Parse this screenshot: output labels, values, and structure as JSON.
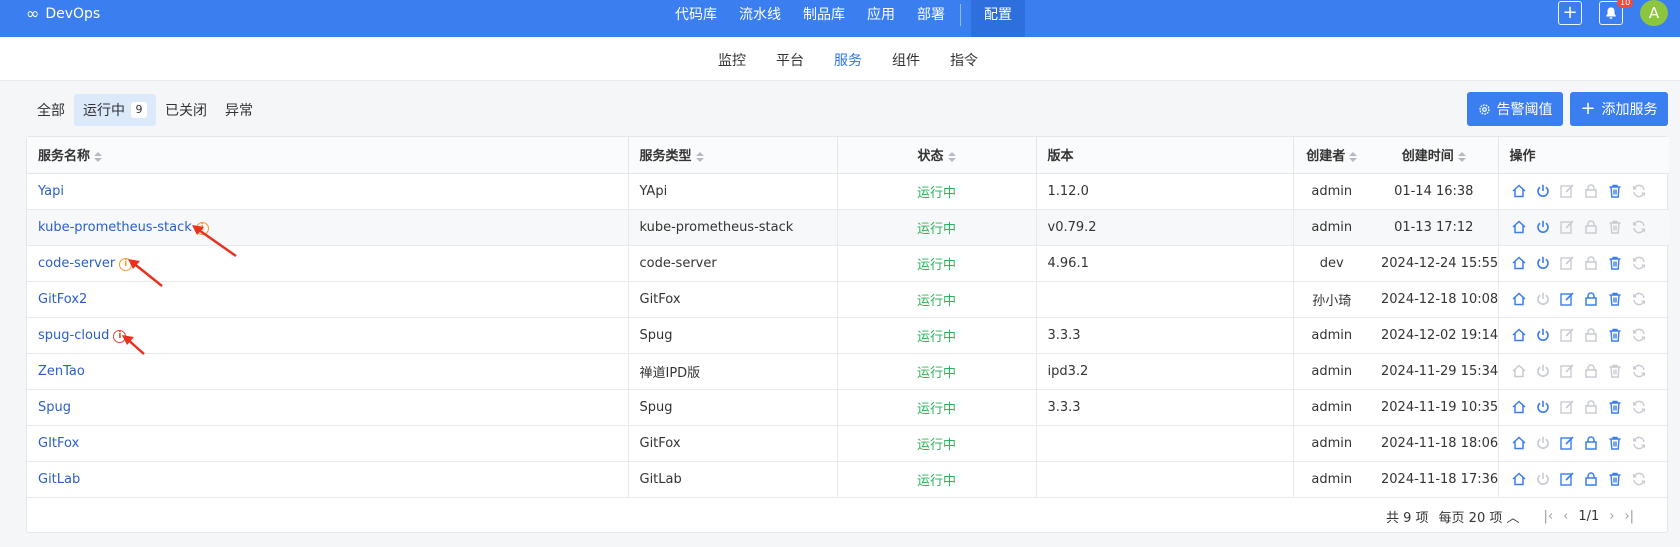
{
  "app": {
    "brand": "DevOps",
    "brand_icon": "infinity-icon"
  },
  "topnav": {
    "items": [
      "代码库",
      "流水线",
      "制品库",
      "应用",
      "部署"
    ],
    "active": "配置"
  },
  "topright": {
    "notification_count": "10",
    "avatar_initial": "A"
  },
  "subnav": {
    "tabs": [
      "监控",
      "平台",
      "服务",
      "组件",
      "指令"
    ],
    "active_index": 2
  },
  "filters": {
    "all": "全部",
    "running": "运行中",
    "running_count": "9",
    "closed": "已关闭",
    "abnormal": "异常"
  },
  "buttons": {
    "alert_threshold": "告警阈值",
    "add_service": "添加服务"
  },
  "table": {
    "headers": {
      "name": "服务名称",
      "type": "服务类型",
      "status": "状态",
      "version": "版本",
      "creator": "创建者",
      "created": "创建时间",
      "actions": "操作"
    },
    "rows": [
      {
        "name": "Yapi",
        "type": "YApi",
        "status": "运行中",
        "version": "1.12.0",
        "creator": "admin",
        "created": "01-14 16:38"
      },
      {
        "name": "kube-prometheus-stack",
        "type": "kube-prometheus-stack",
        "status": "运行中",
        "version": "v0.79.2",
        "creator": "admin",
        "created": "01-13 17:12"
      },
      {
        "name": "code-server",
        "type": "code-server",
        "status": "运行中",
        "version": "4.96.1",
        "creator": "dev",
        "created": "2024-12-24 15:55"
      },
      {
        "name": "GitFox2",
        "type": "GitFox",
        "status": "运行中",
        "version": "",
        "creator": "孙小琦",
        "created": "2024-12-18 10:08"
      },
      {
        "name": "spug-cloud",
        "type": "Spug",
        "status": "运行中",
        "version": "3.3.3",
        "creator": "admin",
        "created": "2024-12-02 19:14"
      },
      {
        "name": "ZenTao",
        "type": "禅道IPD版",
        "status": "运行中",
        "version": "ipd3.2",
        "creator": "admin",
        "created": "2024-11-29 15:34"
      },
      {
        "name": "Spug",
        "type": "Spug",
        "status": "运行中",
        "version": "3.3.3",
        "creator": "admin",
        "created": "2024-11-19 10:35"
      },
      {
        "name": "GItFox",
        "type": "GitFox",
        "status": "运行中",
        "version": "",
        "creator": "admin",
        "created": "2024-11-18 18:06"
      },
      {
        "name": "GitLab",
        "type": "GitLab",
        "status": "运行中",
        "version": "",
        "creator": "admin",
        "created": "2024-11-18 17:36"
      }
    ]
  },
  "pagination": {
    "total": "共 9 项",
    "per_page": "每页 20 项",
    "page": "1/1"
  },
  "colors": {
    "primary": "#3a7ef0",
    "running": "#2fb35a",
    "link": "#2b5ec8",
    "warn": "#f39a2b",
    "error": "#e8473c"
  }
}
